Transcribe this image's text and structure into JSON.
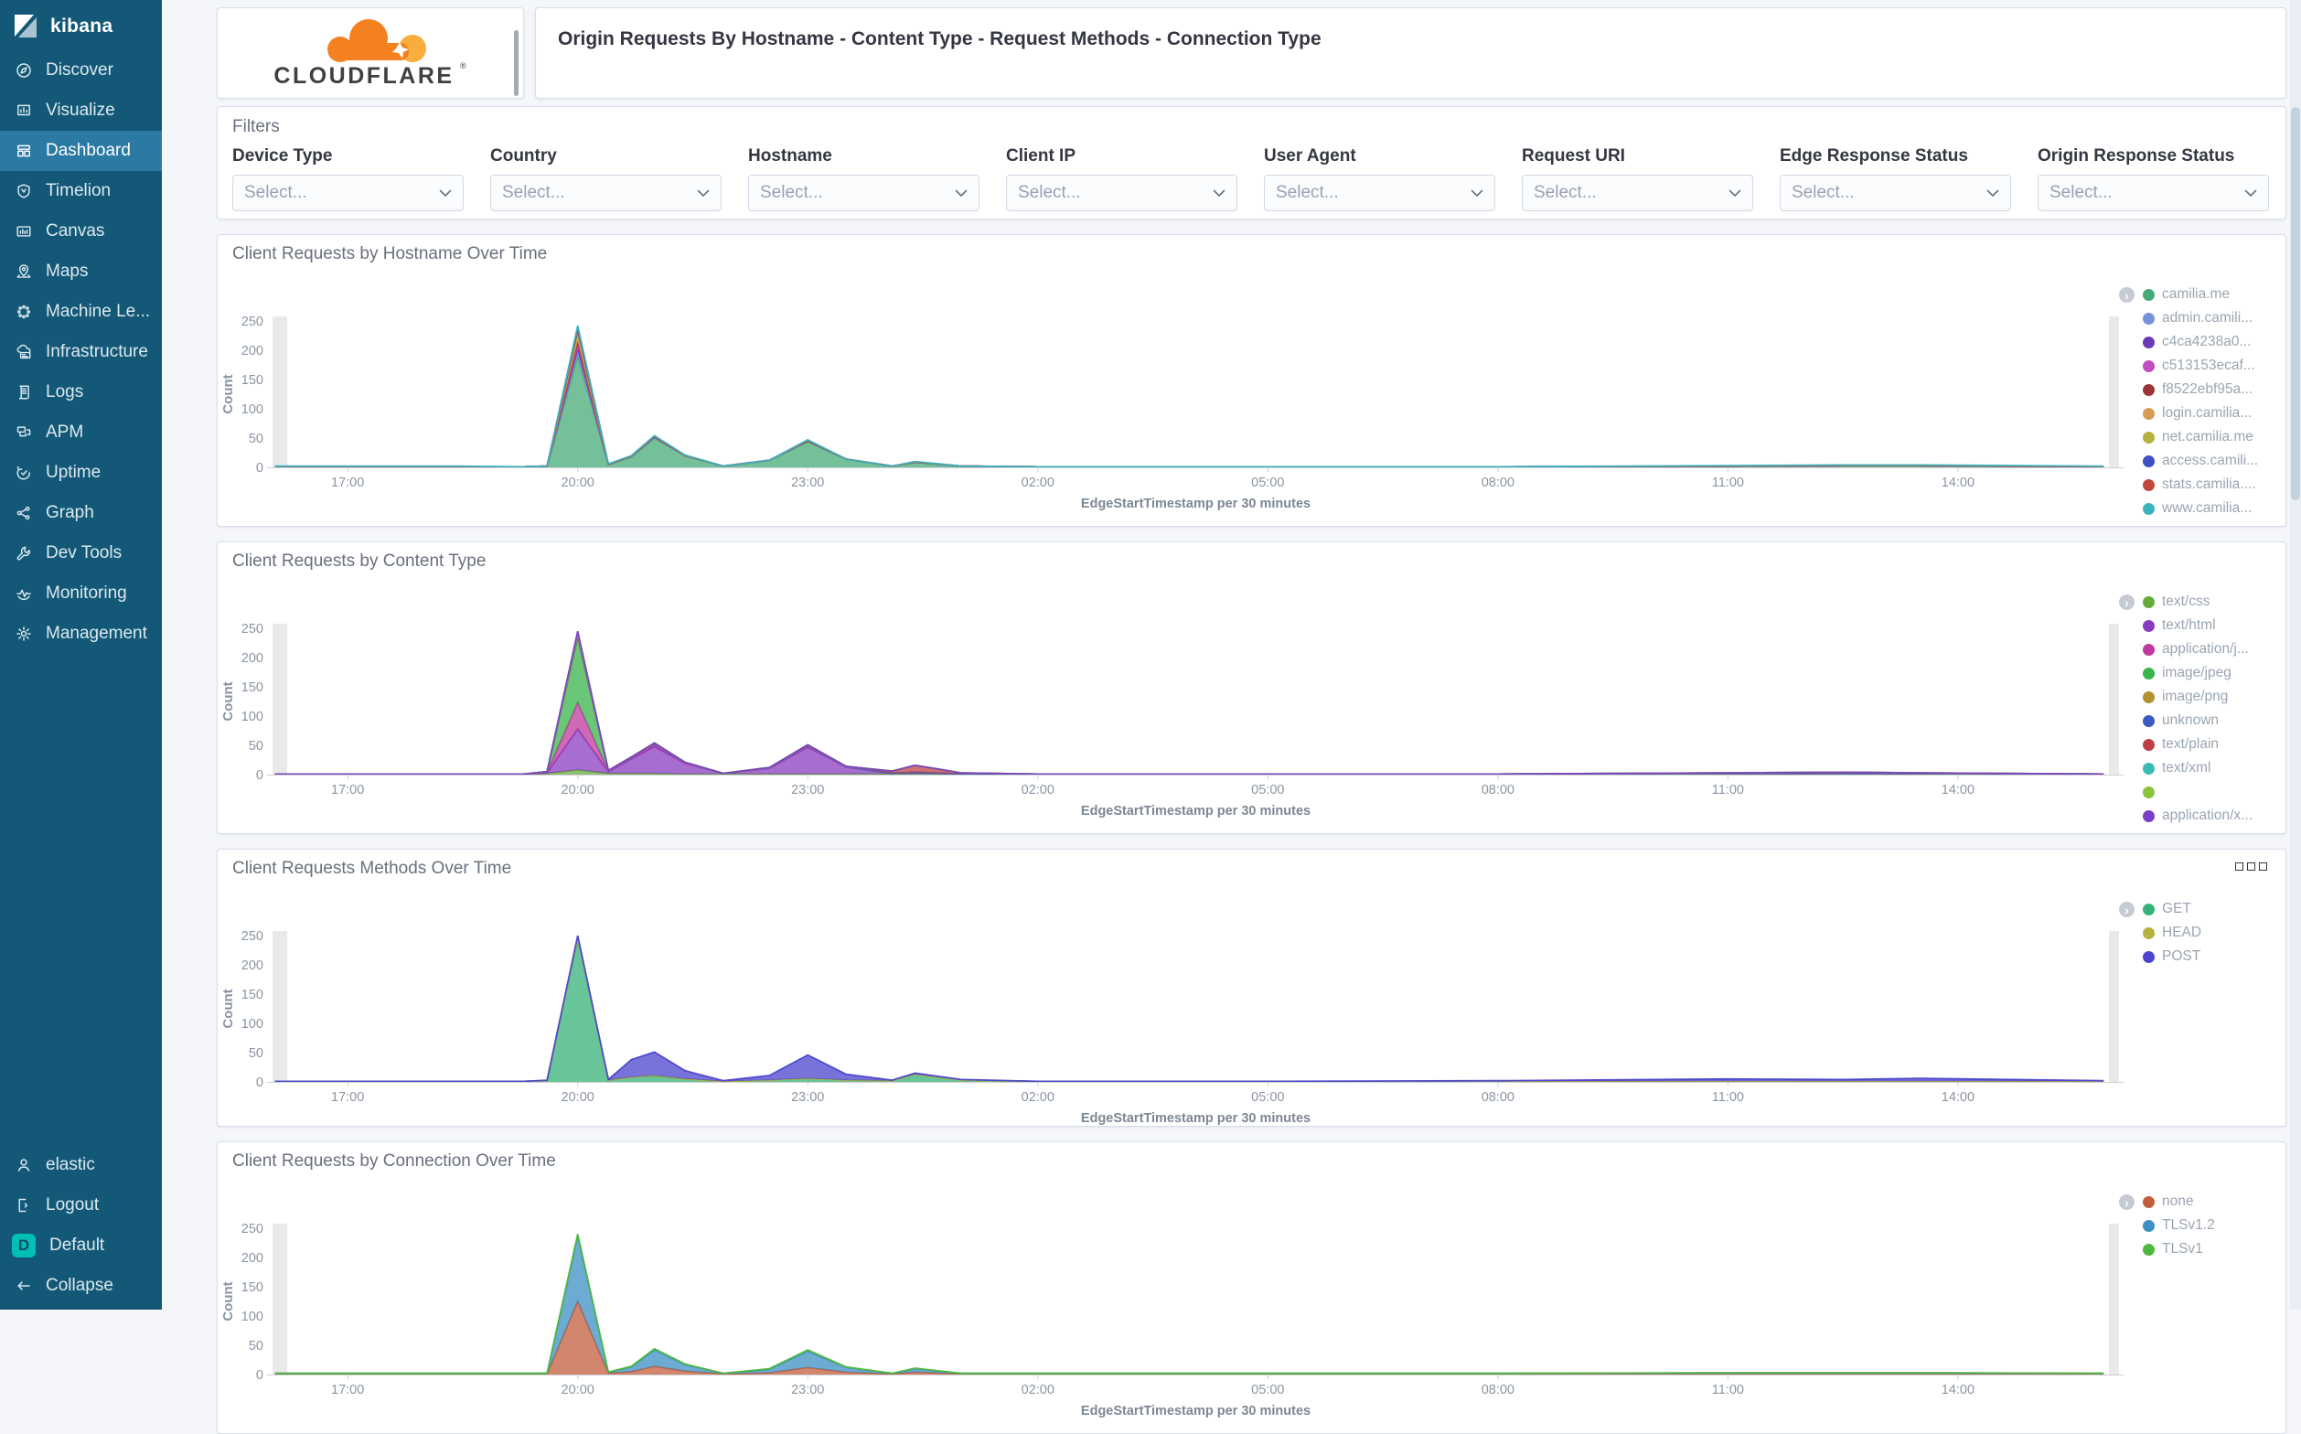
{
  "app": {
    "name": "kibana"
  },
  "sidebar": {
    "items": [
      {
        "label": "Discover",
        "icon": "discover"
      },
      {
        "label": "Visualize",
        "icon": "visualize"
      },
      {
        "label": "Dashboard",
        "icon": "dashboard"
      },
      {
        "label": "Timelion",
        "icon": "timelion"
      },
      {
        "label": "Canvas",
        "icon": "canvas"
      },
      {
        "label": "Maps",
        "icon": "maps"
      },
      {
        "label": "Machine Le...",
        "icon": "machine-learning"
      },
      {
        "label": "Infrastructure",
        "icon": "infrastructure"
      },
      {
        "label": "Logs",
        "icon": "logs"
      },
      {
        "label": "APM",
        "icon": "apm"
      },
      {
        "label": "Uptime",
        "icon": "uptime"
      },
      {
        "label": "Graph",
        "icon": "graph"
      },
      {
        "label": "Dev Tools",
        "icon": "dev-tools"
      },
      {
        "label": "Monitoring",
        "icon": "monitoring"
      },
      {
        "label": "Management",
        "icon": "management"
      }
    ],
    "active": "Dashboard",
    "bottom_items": [
      {
        "label": "elastic",
        "icon": "user"
      },
      {
        "label": "Logout",
        "icon": "logout"
      },
      {
        "label": "Default",
        "icon": "space-default",
        "badge": "D"
      },
      {
        "label": "Collapse",
        "icon": "collapse"
      }
    ]
  },
  "header": {
    "logo_text": "CLOUDFLARE",
    "logo_mark": "®",
    "title": "Origin Requests By Hostname - Content Type - Request Methods - Connection Type"
  },
  "filters": {
    "title": "Filters",
    "placeholder": "Select...",
    "fields": [
      "Device Type",
      "Country",
      "Hostname",
      "Client IP",
      "User Agent",
      "Request URI",
      "Edge Response Status",
      "Origin Response Status"
    ]
  },
  "colors": {
    "sidebar_bg": "#135977",
    "sidebar_active_bg": "#2a7aa4",
    "default_space_badge": "#00bfb3",
    "cloudflare_orange": "#f48120",
    "cloudflare_orange_light": "#faad3f",
    "panel_title_gray": "#69707d",
    "axis_gray": "#8b95a2"
  },
  "chart_data": [
    {
      "type": "area",
      "stacked": true,
      "title": "Client Requests by Hostname Over Time",
      "xlabel": "EdgeStartTimestamp per 30 minutes",
      "ylabel": "Count",
      "ylim": [
        0,
        250
      ],
      "yticks": [
        0,
        50,
        100,
        150,
        200,
        250
      ],
      "xticks": [
        "17:00",
        "20:00",
        "23:00",
        "02:00",
        "05:00",
        "08:00",
        "11:00",
        "14:00"
      ],
      "xtick_hours": [
        17,
        20,
        23,
        26,
        29,
        32,
        35,
        38
      ],
      "xlim_hours": [
        16.02,
        40.1
      ],
      "x_hours": [
        16.05,
        17,
        18.5,
        19.3,
        19.6,
        20,
        20.4,
        20.7,
        21,
        21.4,
        21.9,
        22.5,
        23,
        23.5,
        24.1,
        24.4,
        25,
        26,
        29,
        32,
        35,
        36.5,
        37.5,
        39.9
      ],
      "series": [
        {
          "name": "camilia.me",
          "color": "#44ab77",
          "values": [
            1,
            1,
            1,
            1,
            2,
            190,
            5,
            18,
            50,
            20,
            2,
            12,
            44,
            14,
            2,
            9,
            2,
            1,
            1,
            1,
            2,
            3,
            3,
            1
          ]
        },
        {
          "name": "admin.camili...",
          "color": "#7792da",
          "values": [
            0,
            0,
            0,
            0,
            0,
            8,
            0,
            1,
            1,
            0,
            0,
            0,
            1,
            0,
            0,
            0,
            0,
            0,
            0,
            0,
            0,
            0,
            0,
            0
          ]
        },
        {
          "name": "c4ca4238a0...",
          "color": "#6a39b8",
          "values": [
            0,
            0,
            0,
            0,
            0,
            6,
            0,
            0,
            1,
            0,
            0,
            0,
            0,
            0,
            0,
            0,
            0,
            0,
            0,
            0,
            0,
            0,
            0,
            0
          ]
        },
        {
          "name": "c513153ecaf...",
          "color": "#c14fc1",
          "values": [
            0,
            0,
            0,
            0,
            0,
            6,
            0,
            0,
            0,
            0,
            0,
            0,
            0,
            0,
            0,
            0,
            0,
            0,
            0,
            0,
            0,
            0,
            0,
            0
          ]
        },
        {
          "name": "f8522ebf95a...",
          "color": "#9c3537",
          "values": [
            0,
            0,
            0,
            0,
            0,
            5,
            0,
            0,
            0,
            0,
            0,
            0,
            0,
            0,
            0,
            0,
            0,
            0,
            0,
            0,
            0,
            0,
            0,
            0
          ]
        },
        {
          "name": "login.camilia...",
          "color": "#d89b54",
          "values": [
            0,
            0,
            0,
            0,
            0,
            8,
            0,
            0,
            1,
            0,
            0,
            0,
            1,
            0,
            0,
            0,
            0,
            0,
            0,
            0,
            0,
            0,
            0,
            0
          ]
        },
        {
          "name": "net.camilia.me",
          "color": "#b5b240",
          "values": [
            0,
            0,
            0,
            0,
            0,
            8,
            0,
            0,
            0,
            0,
            0,
            0,
            0,
            0,
            0,
            0,
            0,
            0,
            0,
            0,
            0,
            0,
            0,
            0
          ]
        },
        {
          "name": "access.camili...",
          "color": "#3d4fc3",
          "values": [
            0,
            0,
            0,
            0,
            0,
            4,
            0,
            0,
            0,
            0,
            0,
            0,
            0,
            0,
            0,
            0,
            0,
            0,
            0,
            0,
            0,
            0,
            0,
            0
          ]
        },
        {
          "name": "stats.camilia....",
          "color": "#c2473e",
          "values": [
            0,
            0,
            0,
            0,
            0,
            3,
            0,
            0,
            0,
            0,
            0,
            0,
            0,
            0,
            0,
            0,
            0,
            0,
            0,
            0,
            0,
            0,
            0,
            0
          ]
        },
        {
          "name": "www.camilia...",
          "color": "#3ab5c0",
          "values": [
            1,
            1,
            1,
            0,
            0,
            4,
            1,
            1,
            1,
            1,
            0,
            0,
            1,
            0,
            0,
            1,
            0,
            0,
            0,
            0,
            1,
            1,
            1,
            1
          ]
        }
      ]
    },
    {
      "type": "area",
      "stacked": true,
      "title": "Client Requests by Content Type",
      "xlabel": "EdgeStartTimestamp per 30 minutes",
      "ylabel": "Count",
      "ylim": [
        0,
        250
      ],
      "yticks": [
        0,
        50,
        100,
        150,
        200,
        250
      ],
      "xticks": [
        "17:00",
        "20:00",
        "23:00",
        "02:00",
        "05:00",
        "08:00",
        "11:00",
        "14:00"
      ],
      "xtick_hours": [
        17,
        20,
        23,
        26,
        29,
        32,
        35,
        38
      ],
      "xlim_hours": [
        16.02,
        40.1
      ],
      "x_hours": [
        16.05,
        17,
        18.5,
        19.3,
        19.6,
        20,
        20.4,
        20.7,
        21,
        21.4,
        21.9,
        22.5,
        23,
        23.5,
        24.1,
        24.4,
        25,
        26,
        29,
        32,
        35,
        36.5,
        37.5,
        39.9
      ],
      "series": [
        {
          "name": "text/css",
          "color": "#68a93b",
          "values": [
            1,
            1,
            1,
            1,
            2,
            8,
            2,
            2,
            2,
            1,
            1,
            1,
            1,
            1,
            1,
            1,
            1,
            1,
            1,
            1,
            1,
            1,
            1,
            1
          ]
        },
        {
          "name": "text/html",
          "color": "#8a3cc0",
          "values": [
            0,
            0,
            0,
            0,
            1,
            70,
            3,
            25,
            46,
            18,
            1,
            10,
            46,
            12,
            1,
            2,
            0,
            0,
            0,
            0,
            1,
            1,
            1,
            0
          ]
        },
        {
          "name": "application/j...",
          "color": "#bf3a9e",
          "values": [
            0,
            0,
            0,
            0,
            1,
            45,
            1,
            2,
            3,
            1,
            0,
            1,
            2,
            1,
            0,
            1,
            0,
            0,
            0,
            0,
            0,
            0,
            0,
            0
          ]
        },
        {
          "name": "image/jpeg",
          "color": "#37b44a",
          "values": [
            0,
            0,
            0,
            0,
            1,
            110,
            1,
            1,
            2,
            1,
            0,
            0,
            1,
            0,
            0,
            0,
            0,
            0,
            0,
            0,
            0,
            0,
            0,
            0
          ]
        },
        {
          "name": "image/png",
          "color": "#b3912f",
          "values": [
            0,
            0,
            0,
            0,
            0,
            3,
            0,
            0,
            0,
            0,
            0,
            0,
            0,
            0,
            0,
            0,
            0,
            0,
            0,
            0,
            0,
            0,
            0,
            0
          ]
        },
        {
          "name": "unknown",
          "color": "#3b5bc2",
          "values": [
            0,
            0,
            0,
            0,
            0,
            2,
            0,
            0,
            0,
            0,
            0,
            0,
            0,
            0,
            0,
            0,
            0,
            0,
            0,
            0,
            0,
            0,
            0,
            0
          ]
        },
        {
          "name": "text/plain",
          "color": "#bf3f47",
          "values": [
            0,
            0,
            0,
            0,
            0,
            2,
            0,
            0,
            1,
            0,
            0,
            0,
            1,
            0,
            4,
            12,
            2,
            0,
            0,
            0,
            1,
            2,
            1,
            0
          ]
        },
        {
          "name": "text/xml",
          "color": "#39bcb2",
          "values": [
            0,
            0,
            0,
            0,
            0,
            2,
            0,
            0,
            0,
            0,
            0,
            0,
            0,
            0,
            0,
            0,
            0,
            0,
            0,
            0,
            0,
            0,
            0,
            0
          ]
        },
        {
          "name": "",
          "color": "#8bc43d",
          "values": [
            0,
            0,
            0,
            0,
            0,
            1,
            0,
            0,
            0,
            0,
            0,
            0,
            0,
            0,
            0,
            0,
            0,
            0,
            0,
            0,
            0,
            0,
            0,
            0
          ]
        },
        {
          "name": "application/x...",
          "color": "#7b3dc4",
          "values": [
            0,
            0,
            0,
            0,
            0,
            2,
            0,
            0,
            0,
            0,
            0,
            0,
            0,
            0,
            0,
            0,
            0,
            0,
            0,
            0,
            0,
            0,
            0,
            0
          ]
        }
      ]
    },
    {
      "type": "area",
      "stacked": true,
      "title": "Client Requests Methods Over Time",
      "xlabel": "EdgeStartTimestamp per 30 minutes",
      "ylabel": "Count",
      "ylim": [
        0,
        250
      ],
      "yticks": [
        0,
        50,
        100,
        150,
        200,
        250
      ],
      "xticks": [
        "17:00",
        "20:00",
        "23:00",
        "02:00",
        "05:00",
        "08:00",
        "11:00",
        "14:00"
      ],
      "xtick_hours": [
        17,
        20,
        23,
        26,
        29,
        32,
        35,
        38
      ],
      "xlim_hours": [
        16.02,
        40.1
      ],
      "has_options_icon": true,
      "x_hours": [
        16.05,
        17,
        18.5,
        19.3,
        19.6,
        20,
        20.4,
        20.7,
        21,
        21.4,
        21.9,
        22.5,
        23,
        23.5,
        24.1,
        24.4,
        25,
        26,
        29,
        32,
        35,
        36.5,
        37.5,
        39.9
      ],
      "series": [
        {
          "name": "GET",
          "color": "#35b277",
          "values": [
            1,
            1,
            1,
            1,
            2,
            245,
            3,
            8,
            10,
            5,
            1,
            3,
            6,
            3,
            2,
            13,
            3,
            1,
            1,
            1,
            1,
            1,
            1,
            1
          ]
        },
        {
          "name": "HEAD",
          "color": "#b5b23d",
          "values": [
            0,
            0,
            0,
            0,
            0,
            2,
            0,
            0,
            1,
            0,
            0,
            0,
            0,
            0,
            0,
            0,
            0,
            0,
            0,
            0,
            0,
            0,
            0,
            0
          ]
        },
        {
          "name": "POST",
          "color": "#4b44ce",
          "values": [
            0,
            0,
            0,
            0,
            1,
            3,
            1,
            30,
            40,
            14,
            1,
            8,
            40,
            10,
            1,
            2,
            1,
            0,
            0,
            1,
            4,
            3,
            5,
            1
          ]
        }
      ]
    },
    {
      "type": "area",
      "stacked": true,
      "title": "Client Requests by Connection Over Time",
      "xlabel": "EdgeStartTimestamp per 30 minutes",
      "ylabel": "Count",
      "ylim": [
        0,
        250
      ],
      "yticks": [
        0,
        50,
        100,
        150,
        200,
        250
      ],
      "xticks": [
        "17:00",
        "20:00",
        "23:00",
        "02:00",
        "05:00",
        "08:00",
        "11:00",
        "14:00"
      ],
      "xtick_hours": [
        17,
        20,
        23,
        26,
        29,
        32,
        35,
        38
      ],
      "xlim_hours": [
        16.02,
        40.1
      ],
      "x_hours": [
        16.05,
        17,
        18.5,
        19.3,
        19.6,
        20,
        20.4,
        20.7,
        21,
        21.4,
        21.9,
        22.5,
        23,
        23.5,
        24.1,
        24.4,
        25,
        26,
        29,
        32,
        35,
        36.5,
        37.5,
        39.9
      ],
      "series": [
        {
          "name": "none",
          "color": "#c25e3c",
          "values": [
            1,
            1,
            1,
            1,
            1,
            125,
            2,
            5,
            14,
            6,
            1,
            3,
            12,
            4,
            1,
            4,
            1,
            1,
            1,
            1,
            1,
            1,
            1,
            1
          ]
        },
        {
          "name": "TLSv1.2",
          "color": "#3d8fc4",
          "values": [
            1,
            1,
            1,
            1,
            1,
            112,
            2,
            8,
            28,
            11,
            1,
            6,
            28,
            8,
            1,
            6,
            1,
            1,
            1,
            1,
            2,
            2,
            2,
            1
          ]
        },
        {
          "name": "TLSv1",
          "color": "#4db93c",
          "values": [
            0,
            0,
            0,
            0,
            0,
            3,
            0,
            1,
            2,
            1,
            0,
            1,
            2,
            1,
            0,
            1,
            0,
            0,
            0,
            0,
            0,
            0,
            0,
            0
          ]
        }
      ]
    }
  ]
}
